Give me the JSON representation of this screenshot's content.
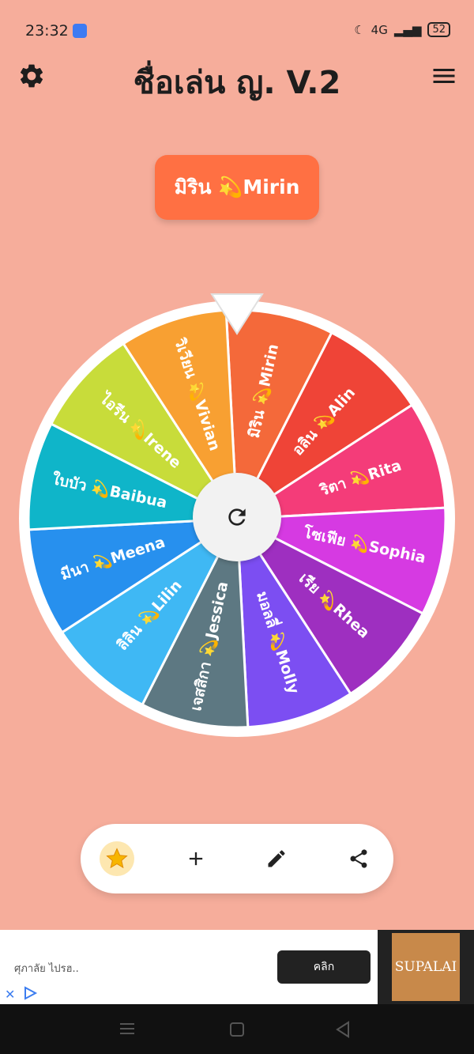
{
  "status": {
    "time": "23:32",
    "network": "4G",
    "battery": "52"
  },
  "header": {
    "title": "ชื่อเล่น ญ.  V.2"
  },
  "result": {
    "label": "มิริน 💫Mirin"
  },
  "wheel": {
    "segments": [
      {
        "label": "มิริน 💫Mirin",
        "color": "#f4693a"
      },
      {
        "label": "อลิน 💫Alin",
        "color": "#ef4437"
      },
      {
        "label": "ริตา 💫Rita",
        "color": "#f43c79"
      },
      {
        "label": "โซเฟีย 💫Sophia",
        "color": "#d63ae2"
      },
      {
        "label": "เรีย 💫Rhea",
        "color": "#9e2fc0"
      },
      {
        "label": "มอลลี่ 💫Molly",
        "color": "#7c4ef2"
      },
      {
        "label": "เจสสิกา 💫Jessica",
        "color": "#5d7882"
      },
      {
        "label": "ลิลิน 💫Lilin",
        "color": "#3fb8f4"
      },
      {
        "label": "มีนา 💫Meena",
        "color": "#2790ee"
      },
      {
        "label": "ใบบัว 💫Baibua",
        "color": "#0fb5c9"
      },
      {
        "label": "ไอรีน 💫Irene",
        "color": "#c8dc3a"
      },
      {
        "label": "วิเวียน 💫Vivian",
        "color": "#f8a032"
      }
    ]
  },
  "ad": {
    "text": "ศุภาลัย ไปรฮ..",
    "cta": "คลิก",
    "brand": "SUPALAI"
  },
  "colors": {
    "background": "#f6ad9b",
    "accent": "#ff7043"
  }
}
